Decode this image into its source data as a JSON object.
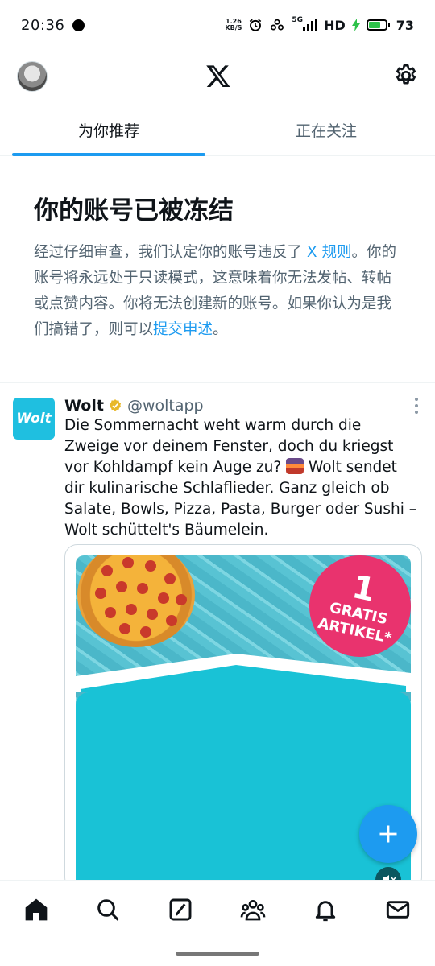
{
  "status_bar": {
    "time": "20:36",
    "net_speed_top": "1.26",
    "net_speed_bottom": "KB/S",
    "network": "5G",
    "hd": "HD",
    "battery": "73",
    "battery_level": 0.73
  },
  "header": {
    "avatar": "profile-avatar",
    "logo": "x-logo-icon",
    "settings": "gear-icon"
  },
  "tabs": [
    {
      "label": "为你推荐",
      "active": true
    },
    {
      "label": "正在关注",
      "active": false
    }
  ],
  "notice": {
    "title": "你的账号已被冻结",
    "body_before_link1": "经过仔细审查，我们认定你的账号违反了",
    "link1": "X 规则",
    "body_middle": "。你的账号将永远处于只读模式，这意味着你无法发帖、转帖或点赞内容。你将无法创建新的账号。如果你认为是我们搞错了，则可以",
    "link2": "提交申述",
    "body_end": "。"
  },
  "tweet": {
    "avatar_text": "Wolt",
    "name": "Wolt",
    "handle": "@woltapp",
    "text_part1": "Die Sommernacht weht warm durch die Zweige vor deinem Fenster, doch du kriegst vor Kohldampf kein Auge zu?",
    "text_part2": "Wolt sendet dir kulinarische Schlaflieder. Ganz gleich ob Salate, Bowls, Pizza, Pasta, Burger oder Sushi – Wolt schüttelt's Bäumelein.",
    "media": {
      "badge_number": "1",
      "badge_text_1": "GRATIS",
      "badge_text_2": "ARTIKEL*"
    }
  },
  "fab": {
    "icon": "plus-icon"
  },
  "bottom_nav": [
    "home-icon",
    "search-icon",
    "grok-icon",
    "communities-icon",
    "notifications-icon",
    "messages-icon"
  ],
  "colors": {
    "accent": "#1d9bf0",
    "text": "#0f1419",
    "secondary": "#536471",
    "wolt": "#1fbfe0",
    "badge": "#e9336e"
  }
}
